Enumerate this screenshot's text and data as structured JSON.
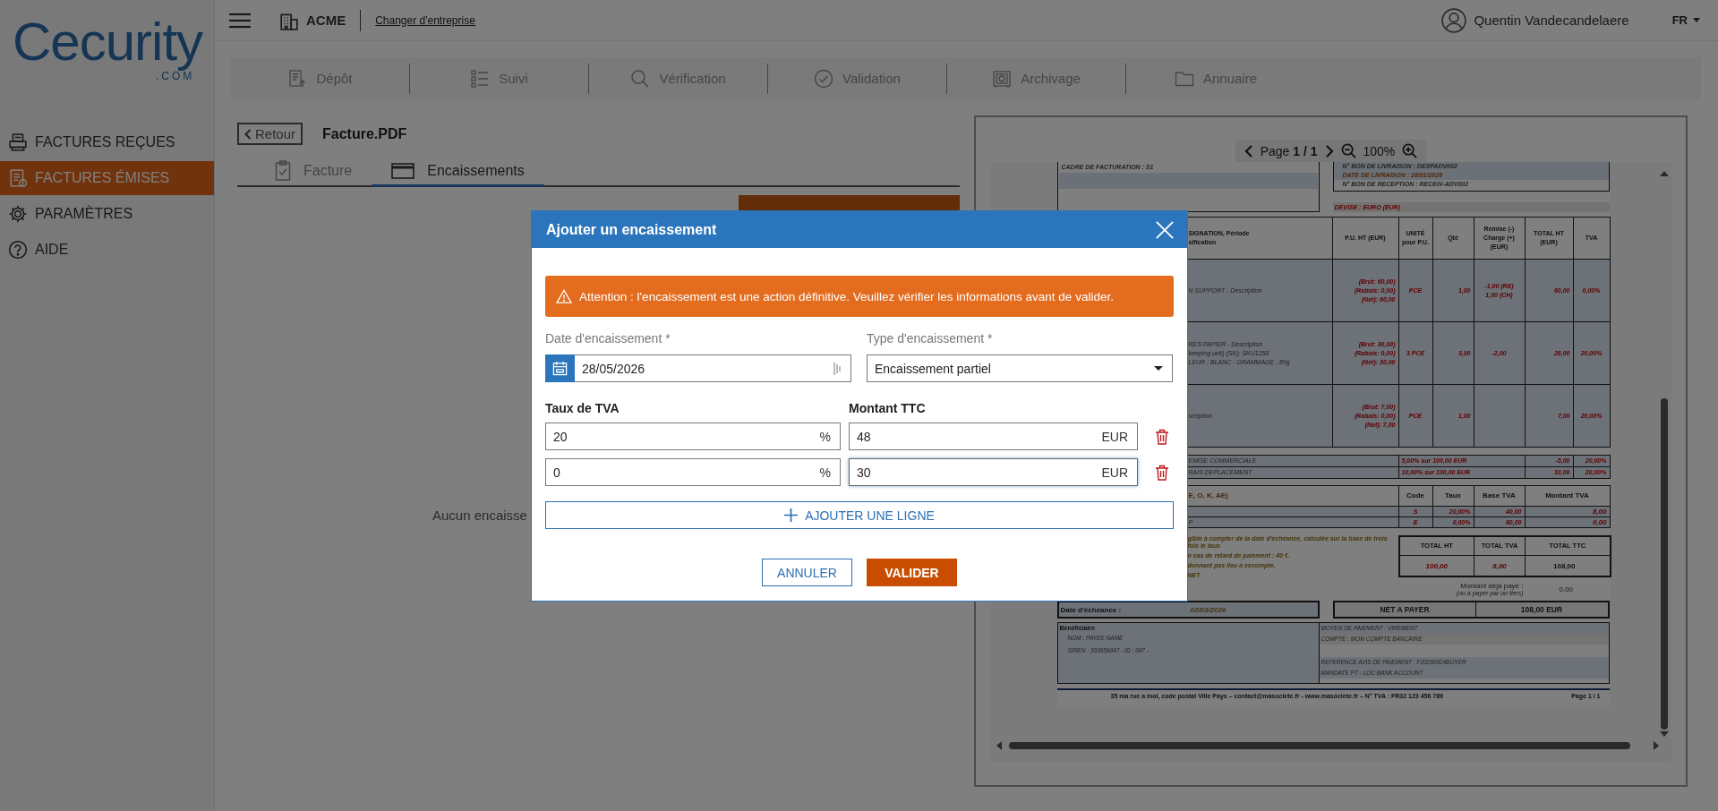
{
  "logo": {
    "name": "Cecurity",
    "suffix": ".COM"
  },
  "sidebar": {
    "items": [
      {
        "label": "FACTURES REÇUES",
        "selected": false
      },
      {
        "label": "FACTURES ÉMISES",
        "selected": true
      },
      {
        "label": "PARAMÈTRES",
        "selected": false
      },
      {
        "label": "AIDE",
        "selected": false
      }
    ]
  },
  "top_bar": {
    "company": "ACME",
    "switch_link": "Changer d'entreprise",
    "user": "Quentin Vandecandelaere",
    "language": "FR"
  },
  "nav": {
    "items": [
      "Dépôt",
      "Suivi",
      "Vérification",
      "Validation",
      "Archivage",
      "Annuaire"
    ]
  },
  "page": {
    "back": "Retour",
    "title": "Facture.PDF",
    "tabs": [
      {
        "label": "Facture",
        "selected": false
      },
      {
        "label": "Encaissements",
        "selected": true
      }
    ],
    "empty_text": "Aucun encaisse"
  },
  "preview": {
    "pager": {
      "label": "Page",
      "current": "1 / 1",
      "zoom": "100%"
    },
    "document": {
      "billing_frame": "CADRE DE FACTURATION : S1",
      "delivery": [
        "N° BON DE LIVRAISON : DESPADV002",
        "DATE DE LIVRAISON : 28/01/2026",
        "N° BON DE RECEPTION : RECEIV-ADV002"
      ],
      "currency": "DEVISE : EURO (EUR)",
      "columns": [
        [
          "SIGNATION, Période",
          "sification"
        ],
        [
          "P.U. HT (EUR)"
        ],
        [
          "UNITÉ",
          "pour P.U."
        ],
        [
          "Qté"
        ],
        [
          "Remise (-)",
          "Charge (+)",
          "(EUR)"
        ],
        [
          "TOTAL HT",
          "(EUR)"
        ],
        [
          "TVA"
        ]
      ],
      "rows": [
        {
          "description": [
            "N SUPPORT - Description"
          ],
          "unit_price": [
            "(Brut: 60,00)",
            "(Rabais: 0,00)",
            "(Net): 60,00"
          ],
          "unit": "PCE",
          "quantity": "1,00",
          "adjustment": [
            "-1,00 (RE)",
            "1,00 (CH)"
          ],
          "total": "60,00",
          "vat": "0,00%"
        },
        {
          "description": [
            "RES PAPIER - Description",
            "keeping unit) (SK): SKU1258",
            "LEUR : BLANC - GRAMMAGE : 80g"
          ],
          "unit_price": [
            "(Brut: 30,00)",
            "(Rabais: 0,00)",
            "(Net): 30,00"
          ],
          "unit": "3 PCE",
          "quantity": "3,00",
          "adjustment": [
            "-2,00"
          ],
          "total": "28,00",
          "vat": "20,00%"
        },
        {
          "description": [
            "scription"
          ],
          "unit_price": [
            "(Brut: 7,00)",
            "(Rabais: 0,00)",
            "(Net): 7,00"
          ],
          "unit": "PCE",
          "quantity": "1,00",
          "adjustment": [],
          "total": "7,00",
          "vat": "20,00%"
        }
      ],
      "charges": [
        {
          "label": "EMISE COMMERCIALE",
          "basis": "5,00% sur 100,00 EUR",
          "amount": "-5,00",
          "vat": "20,00%"
        },
        {
          "label": "RAIS DEPLACEMENT",
          "basis": "10,00% sur 100,00 EUR",
          "amount": "10,00",
          "vat": "20,00%"
        }
      ],
      "vat_columns": [
        "E, O, K, AE)",
        "Code",
        "Taux",
        "Base TVA",
        "Montant TVA"
      ],
      "vat_rows": [
        {
          "code": "S",
          "rate": "20,00%",
          "base": "40,00",
          "amount": "8,00"
        },
        {
          "label": "P",
          "code": "E",
          "rate": "0,00%",
          "base": "60,00",
          "amount": "0,00"
        }
      ],
      "notes": [
        "gible à compter de la date d'échéance, calculée sur la base de trois fois le taux",
        "n cas de retard de paiement : 40 €.",
        "donnant pas lieu à escompte.",
        "NET"
      ],
      "totals": {
        "columns": [
          "TOTAL HT",
          "TOTAL TVA",
          "TOTAL TTC"
        ],
        "values": [
          "100,00",
          "8,00",
          "108,00"
        ]
      },
      "paid": {
        "label": "Montant déjà payé :",
        "note": "(ou à payer par un tiers)",
        "value": "0,00"
      },
      "due": {
        "label": "Date d'échéance :",
        "value": "02/03/2026"
      },
      "net": {
        "label": "NET A PAYER",
        "value": "108,00 EUR"
      },
      "beneficiary": {
        "title": "Bénéficiaire",
        "lines": [
          "NOM : PAYEE NAME",
          "SIREN : 303656847 - ID : 987 -"
        ]
      },
      "payment": [
        "MOYEN DE PAIEMENT : VIREMENT",
        "COMPTE : MON COMPTE BANCAIRE",
        "REFERENCE AVIS DE PAIEMENT : F20260024BUYER",
        "MANDATE PT - LOC BANK ACCOUNT"
      ],
      "footer": {
        "address": "35 ma rue a moi, code postal Ville Pays – contact@masociete.fr - www.masociete.fr – N° TVA : FR32 123 456 789",
        "page": "Page 1 / 1"
      }
    }
  },
  "dialog": {
    "title": "Ajouter un encaissement",
    "warning": "Attention : l'encaissement est une action définitive. Veuillez vérifier les informations avant de valider.",
    "date": {
      "label": "Date d'encaissement *",
      "value": "28/05/2026"
    },
    "type": {
      "label": "Type d'encaissement *",
      "value": "Encaissement partiel"
    },
    "columns": [
      "Taux de TVA",
      "Montant TTC"
    ],
    "lines": [
      {
        "rate": "20",
        "rate_unit": "%",
        "amount": "48",
        "currency": "EUR",
        "focused": false
      },
      {
        "rate": "0",
        "rate_unit": "%",
        "amount": "30",
        "currency": "EUR",
        "focused": true
      }
    ],
    "add_line": "AJOUTER UNE LIGNE",
    "cancel": "ANNULER",
    "confirm": "VALIDER"
  }
}
